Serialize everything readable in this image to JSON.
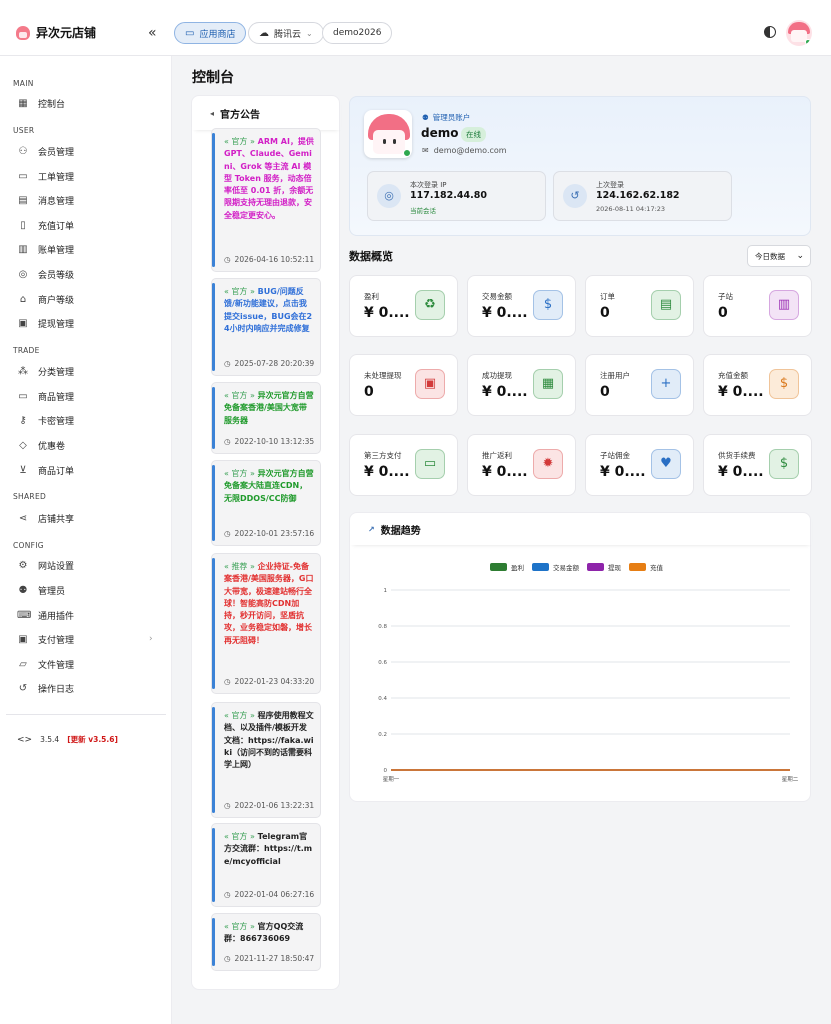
{
  "app": {
    "title": "异次元店铺"
  },
  "topbar": {
    "collapse_icon": "«",
    "pills": [
      {
        "label": "应用商店",
        "icon": "store-icon",
        "active": true
      },
      {
        "label": "腾讯云",
        "icon": "cloud-icon",
        "active": false
      },
      {
        "label": "demo2026",
        "active": false
      }
    ]
  },
  "sidebar": {
    "sections": [
      {
        "title": "MAIN",
        "items": [
          {
            "label": "控制台",
            "icon": "dashboard-icon"
          }
        ]
      },
      {
        "title": "USER",
        "items": [
          {
            "label": "会员管理",
            "icon": "users-icon"
          },
          {
            "label": "工单管理",
            "icon": "ticket-icon"
          },
          {
            "label": "消息管理",
            "icon": "message-icon"
          },
          {
            "label": "充值订单",
            "icon": "receipt-icon"
          },
          {
            "label": "账单管理",
            "icon": "bill-icon"
          },
          {
            "label": "会员等级",
            "icon": "badge-icon"
          },
          {
            "label": "商户等级",
            "icon": "shop-icon"
          },
          {
            "label": "提现管理",
            "icon": "wallet-icon"
          }
        ]
      },
      {
        "title": "TRADE",
        "items": [
          {
            "label": "分类管理",
            "icon": "category-icon"
          },
          {
            "label": "商品管理",
            "icon": "box-icon"
          },
          {
            "label": "卡密管理",
            "icon": "key-icon"
          },
          {
            "label": "优惠卷",
            "icon": "tag-icon"
          },
          {
            "label": "商品订单",
            "icon": "cart-icon"
          }
        ]
      },
      {
        "title": "SHARED",
        "items": [
          {
            "label": "店铺共享",
            "icon": "share-icon"
          }
        ]
      },
      {
        "title": "CONFIG",
        "items": [
          {
            "label": "网站设置",
            "icon": "gear-icon"
          },
          {
            "label": "管理员",
            "icon": "admin-icon"
          },
          {
            "label": "通用插件",
            "icon": "plugin-icon"
          },
          {
            "label": "支付管理",
            "icon": "payment-icon",
            "chevron": "›"
          },
          {
            "label": "文件管理",
            "icon": "folder-icon"
          },
          {
            "label": "操作日志",
            "icon": "history-icon"
          }
        ]
      }
    ],
    "version": {
      "code_icon": "<>",
      "number": "3.5.4",
      "update": "[更新 v3.5.6]"
    }
  },
  "page": {
    "title": "控制台"
  },
  "announcements": {
    "title": "官方公告",
    "items": [
      {
        "tag": "« 官方 »",
        "text": "ARM AI，提供 GPT、Claude、Gemini、Grok 等主流 AI 模型 Token 服务，动态倍率低至 0.01 折，余额无限期支持无理由退款，安全稳定更安心。",
        "time": "2026-04-16 10:52:11",
        "color": "#d21fc6"
      },
      {
        "tag": "« 官方 »",
        "text": "BUG/问题反馈/新功能建议，点击我提交issue，BUG会在24小时内响应并完成修复",
        "time": "2025-07-28 20:20:39",
        "color": "#2f6fd8"
      },
      {
        "tag": "« 官方 »",
        "text": "异次元官方自营免备案香港/美国大宽带服务器",
        "time": "2022-10-10 13:12:35",
        "color": "#1f9a2b"
      },
      {
        "tag": "« 官方 »",
        "text": "异次元官方自营免备案大陆直连CDN，无限DDOS/CC防御",
        "time": "2022-10-01 23:57:16",
        "color": "#1f9a2b"
      },
      {
        "tag": "« 推荐 »",
        "text": "企业持证-免备案香港/美国服务器，G口大带宽，极速建站畅行全球！智能高防CDN加持，秒开访问，坚盾抗攻，业务稳定如磐，增长再无阻碍！",
        "time": "2022-01-23 04:33:20",
        "color": "#e23030"
      },
      {
        "tag": "« 官方 »",
        "text": "程序使用教程文档、以及插件/模板开发文档：https://faka.wiki（访问不到的话需要科学上网）",
        "time": "2022-01-06 13:22:31",
        "color": "#222222"
      },
      {
        "tag": "« 官方 »",
        "text": "Telegram官方交流群：https://t.me/mcyofficial",
        "time": "2022-01-04 06:27:16",
        "color": "#222222"
      },
      {
        "tag": "« 官方 »",
        "text": "官方QQ交流群：866736069",
        "time": "2021-11-27 18:50:47",
        "color": "#222222"
      }
    ]
  },
  "profile": {
    "role": "管理员账户",
    "name": "demo",
    "status": "在线",
    "email": "demo@demo.com",
    "current_login": {
      "label": "本次登录 IP",
      "ip": "117.182.44.80",
      "sub": "当前会话"
    },
    "last_login": {
      "label": "上次登录",
      "ip": "124.162.62.182",
      "sub": "2026-08-11 04:17:23"
    }
  },
  "overview": {
    "title": "数据概览",
    "range": "今日数据",
    "range_chevron": "⌄",
    "stats": [
      {
        "label": "盈利",
        "value": "¥ 0....",
        "icon": "piggy-icon",
        "glyph": "♻",
        "color": "#2e8b3e",
        "bg": "#e2f2e4"
      },
      {
        "label": "交易金额",
        "value": "¥ 0....",
        "icon": "dollar-icon",
        "glyph": "$",
        "color": "#2a6fc4",
        "bg": "#e1ecf8"
      },
      {
        "label": "订单",
        "value": "0",
        "icon": "list-icon",
        "glyph": "▤",
        "color": "#2e8b3e",
        "bg": "#e2f2e4"
      },
      {
        "label": "子站",
        "value": "0",
        "icon": "store-icon",
        "glyph": "▥",
        "color": "#9b2fb4",
        "bg": "#f3e3f6"
      },
      {
        "label": "未处理提现",
        "value": "0",
        "icon": "cash-icon",
        "glyph": "▣",
        "color": "#d23a3a",
        "bg": "#fbe4e4"
      },
      {
        "label": "成功提现",
        "value": "¥ 0....",
        "icon": "money-icon",
        "glyph": "▦",
        "color": "#2e8b3e",
        "bg": "#e2f2e4"
      },
      {
        "label": "注册用户",
        "value": "0",
        "icon": "add-user-icon",
        "glyph": "+",
        "color": "#2a6fc4",
        "bg": "#e1ecf8"
      },
      {
        "label": "充值金额",
        "value": "¥ 0....",
        "icon": "coin-icon",
        "glyph": "$",
        "color": "#d9771a",
        "bg": "#fcebd9"
      },
      {
        "label": "第三方支付",
        "value": "¥ 0....",
        "icon": "card-icon",
        "glyph": "▭",
        "color": "#2e8b3e",
        "bg": "#e2f2e4"
      },
      {
        "label": "推广返利",
        "value": "¥ 0....",
        "icon": "megaphone-icon",
        "glyph": "✹",
        "color": "#d23a3a",
        "bg": "#fbe4e4"
      },
      {
        "label": "子站佣金",
        "value": "¥ 0....",
        "icon": "hand-heart-icon",
        "glyph": "♥",
        "color": "#2a6fc4",
        "bg": "#e1ecf8"
      },
      {
        "label": "供货手续费",
        "value": "¥ 0....",
        "icon": "fee-icon",
        "glyph": "$",
        "color": "#2e8b3e",
        "bg": "#e2f2e4"
      }
    ]
  },
  "trend": {
    "title": "数据趋势"
  },
  "chart_data": {
    "type": "line",
    "categories": [
      "星期一",
      "星期二"
    ],
    "series": [
      {
        "name": "盈利",
        "values": [
          0,
          0
        ],
        "color": "#2e7d32"
      },
      {
        "name": "交易金额",
        "values": [
          0,
          0
        ],
        "color": "#1e73c8"
      },
      {
        "name": "提现",
        "values": [
          0,
          0
        ],
        "color": "#8e24aa"
      },
      {
        "name": "充值",
        "values": [
          0,
          0
        ],
        "color": "#e67e14"
      }
    ],
    "ylim": [
      0,
      1
    ],
    "yticks": [
      "1",
      "0.8",
      "0.6",
      "0.4",
      "0.2",
      "0"
    ],
    "grid": true,
    "legend": "top-center",
    "title": "",
    "xlabel": "",
    "ylabel": ""
  }
}
